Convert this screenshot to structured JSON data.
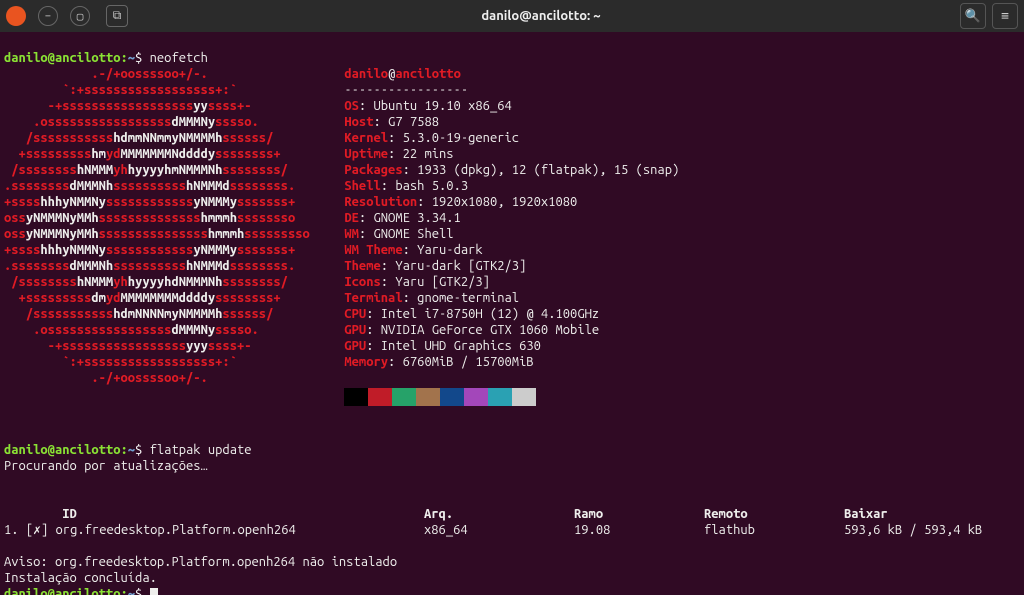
{
  "window": {
    "title": "danilo@ancilotto: ~"
  },
  "prompt1": {
    "userhost": "danilo@ancilotto",
    "path": "~",
    "cmd": "neofetch"
  },
  "ascii_logo": [
    [
      [
        "lw",
        "            .-/+oossssoo+/-.               "
      ]
    ],
    [
      [
        "lw",
        "        `:+ssssssssssssssssss+:`           "
      ]
    ],
    [
      [
        "lw",
        "      -+ssssssssssssssssss"
      ],
      [
        "ld",
        "yy"
      ],
      [
        "lw",
        "ssss+-         "
      ]
    ],
    [
      [
        "lw",
        "    .osssssssssssssssss"
      ],
      [
        "ld",
        "dMMMNy"
      ],
      [
        "lw",
        "sssso.       "
      ]
    ],
    [
      [
        "lw",
        "   /sssssssssss"
      ],
      [
        "ld",
        "hdmmNNmmyNMMMMh"
      ],
      [
        "lw",
        "ssssss/      "
      ]
    ],
    [
      [
        "lw",
        "  +sssssssss"
      ],
      [
        "ld",
        "hm"
      ],
      [
        "lw",
        "yd"
      ],
      [
        "ld",
        "MMMMMMMNddddy"
      ],
      [
        "lw",
        "ssssssss+     "
      ]
    ],
    [
      [
        "lw",
        " /ssssssss"
      ],
      [
        "ld",
        "hNMMM"
      ],
      [
        "lw",
        "yh"
      ],
      [
        "ld",
        "hyyyyhmNMMMNh"
      ],
      [
        "lw",
        "ssssssss/    "
      ]
    ],
    [
      [
        "lw",
        ".ssssssss"
      ],
      [
        "ld",
        "dMMMNh"
      ],
      [
        "lw",
        "ssssssssss"
      ],
      [
        "ld",
        "hNMMMd"
      ],
      [
        "lw",
        "ssssssss.   "
      ]
    ],
    [
      [
        "lw",
        "+ssss"
      ],
      [
        "ld",
        "hhhyNMMNy"
      ],
      [
        "lw",
        "ssssssssssss"
      ],
      [
        "ld",
        "yNMMMy"
      ],
      [
        "lw",
        "sssssss+   "
      ]
    ],
    [
      [
        "lw",
        "oss"
      ],
      [
        "ld",
        "yNMMMNyMMh"
      ],
      [
        "lw",
        "ssssssssssssss"
      ],
      [
        "ld",
        "hmmmh"
      ],
      [
        "lw",
        "ssssssso   "
      ]
    ],
    [
      [
        "lw",
        "oss"
      ],
      [
        "ld",
        "yNMMMNyMMh"
      ],
      [
        "lw",
        "sssssssssssssss"
      ],
      [
        "ld",
        "hmmmh"
      ],
      [
        "lw",
        "sssssssso  "
      ]
    ],
    [
      [
        "lw",
        "+ssss"
      ],
      [
        "ld",
        "hhhyNMMNy"
      ],
      [
        "lw",
        "ssssssssssss"
      ],
      [
        "ld",
        "yNMMMy"
      ],
      [
        "lw",
        "sssssss+   "
      ]
    ],
    [
      [
        "lw",
        ".ssssssss"
      ],
      [
        "ld",
        "dMMMNh"
      ],
      [
        "lw",
        "ssssssssss"
      ],
      [
        "ld",
        "hNMMMd"
      ],
      [
        "lw",
        "ssssssss.   "
      ]
    ],
    [
      [
        "lw",
        " /ssssssss"
      ],
      [
        "ld",
        "hNMMM"
      ],
      [
        "lw",
        "yh"
      ],
      [
        "ld",
        "hyyyyhdNMMMNh"
      ],
      [
        "lw",
        "ssssssss/    "
      ]
    ],
    [
      [
        "lw",
        "  +sssssssss"
      ],
      [
        "ld",
        "dm"
      ],
      [
        "lw",
        "yd"
      ],
      [
        "ld",
        "MMMMMMMMddddy"
      ],
      [
        "lw",
        "ssssssss+     "
      ]
    ],
    [
      [
        "lw",
        "   /sssssssssss"
      ],
      [
        "ld",
        "hdmNNNNmyNMMMMh"
      ],
      [
        "lw",
        "ssssss/      "
      ]
    ],
    [
      [
        "lw",
        "    .osssssssssssssssss"
      ],
      [
        "ld",
        "dMMMNy"
      ],
      [
        "lw",
        "sssso.       "
      ]
    ],
    [
      [
        "lw",
        "      -+sssssssssssssssss"
      ],
      [
        "ld",
        "yyy"
      ],
      [
        "lw",
        "ssss+-         "
      ]
    ],
    [
      [
        "lw",
        "        `:+ssssssssssssssssss+:`           "
      ]
    ],
    [
      [
        "lw",
        "            .-/+oossssoo+/-.               "
      ]
    ]
  ],
  "neofetch": {
    "user": "danilo",
    "at": "@",
    "host": "ancilotto",
    "rule": "-----------------",
    "rows": [
      [
        "OS",
        "Ubuntu 19.10 x86_64"
      ],
      [
        "Host",
        "G7 7588"
      ],
      [
        "Kernel",
        "5.3.0-19-generic"
      ],
      [
        "Uptime",
        "22 mins"
      ],
      [
        "Packages",
        "1933 (dpkg), 12 (flatpak), 15 (snap)"
      ],
      [
        "Shell",
        "bash 5.0.3"
      ],
      [
        "Resolution",
        "1920x1080, 1920x1080"
      ],
      [
        "DE",
        "GNOME 3.34.1"
      ],
      [
        "WM",
        "GNOME Shell"
      ],
      [
        "WM Theme",
        "Yaru-dark"
      ],
      [
        "Theme",
        "Yaru-dark [GTK2/3]"
      ],
      [
        "Icons",
        "Yaru [GTK2/3]"
      ],
      [
        "Terminal",
        "gnome-terminal"
      ],
      [
        "CPU",
        "Intel i7-8750H (12) @ 4.100GHz"
      ],
      [
        "GPU",
        "NVIDIA GeForce GTX 1060 Mobile"
      ],
      [
        "GPU",
        "Intel UHD Graphics 630"
      ],
      [
        "Memory",
        "6760MiB / 15700MiB"
      ]
    ]
  },
  "swatches": [
    "#000000",
    "#c01c28",
    "#26a269",
    "#a2734c",
    "#12488b",
    "#a347ba",
    "#2aa1b3",
    "#cccccc"
  ],
  "prompt2": {
    "userhost": "danilo@ancilotto",
    "path": "~",
    "cmd": "flatpak update"
  },
  "flatpak": {
    "searching": "Procurando por atualizações…",
    "headers": {
      "id": "ID",
      "arch": "Arq.",
      "ramo": "Ramo",
      "remoto": "Remoto",
      "baixar": "Baixar"
    },
    "row": {
      "num": "1.",
      "check": "[✗]",
      "id": "org.freedesktop.Platform.openh264",
      "arch": "x86_64",
      "ramo": "19.08",
      "remoto": "flathub",
      "baixar": "593,6 kB / 593,4 kB"
    },
    "warning": "Aviso: org.freedesktop.Platform.openh264 não instalado",
    "done": "Instalação concluída."
  },
  "prompt3": {
    "userhost": "danilo@ancilotto",
    "path": "~"
  }
}
